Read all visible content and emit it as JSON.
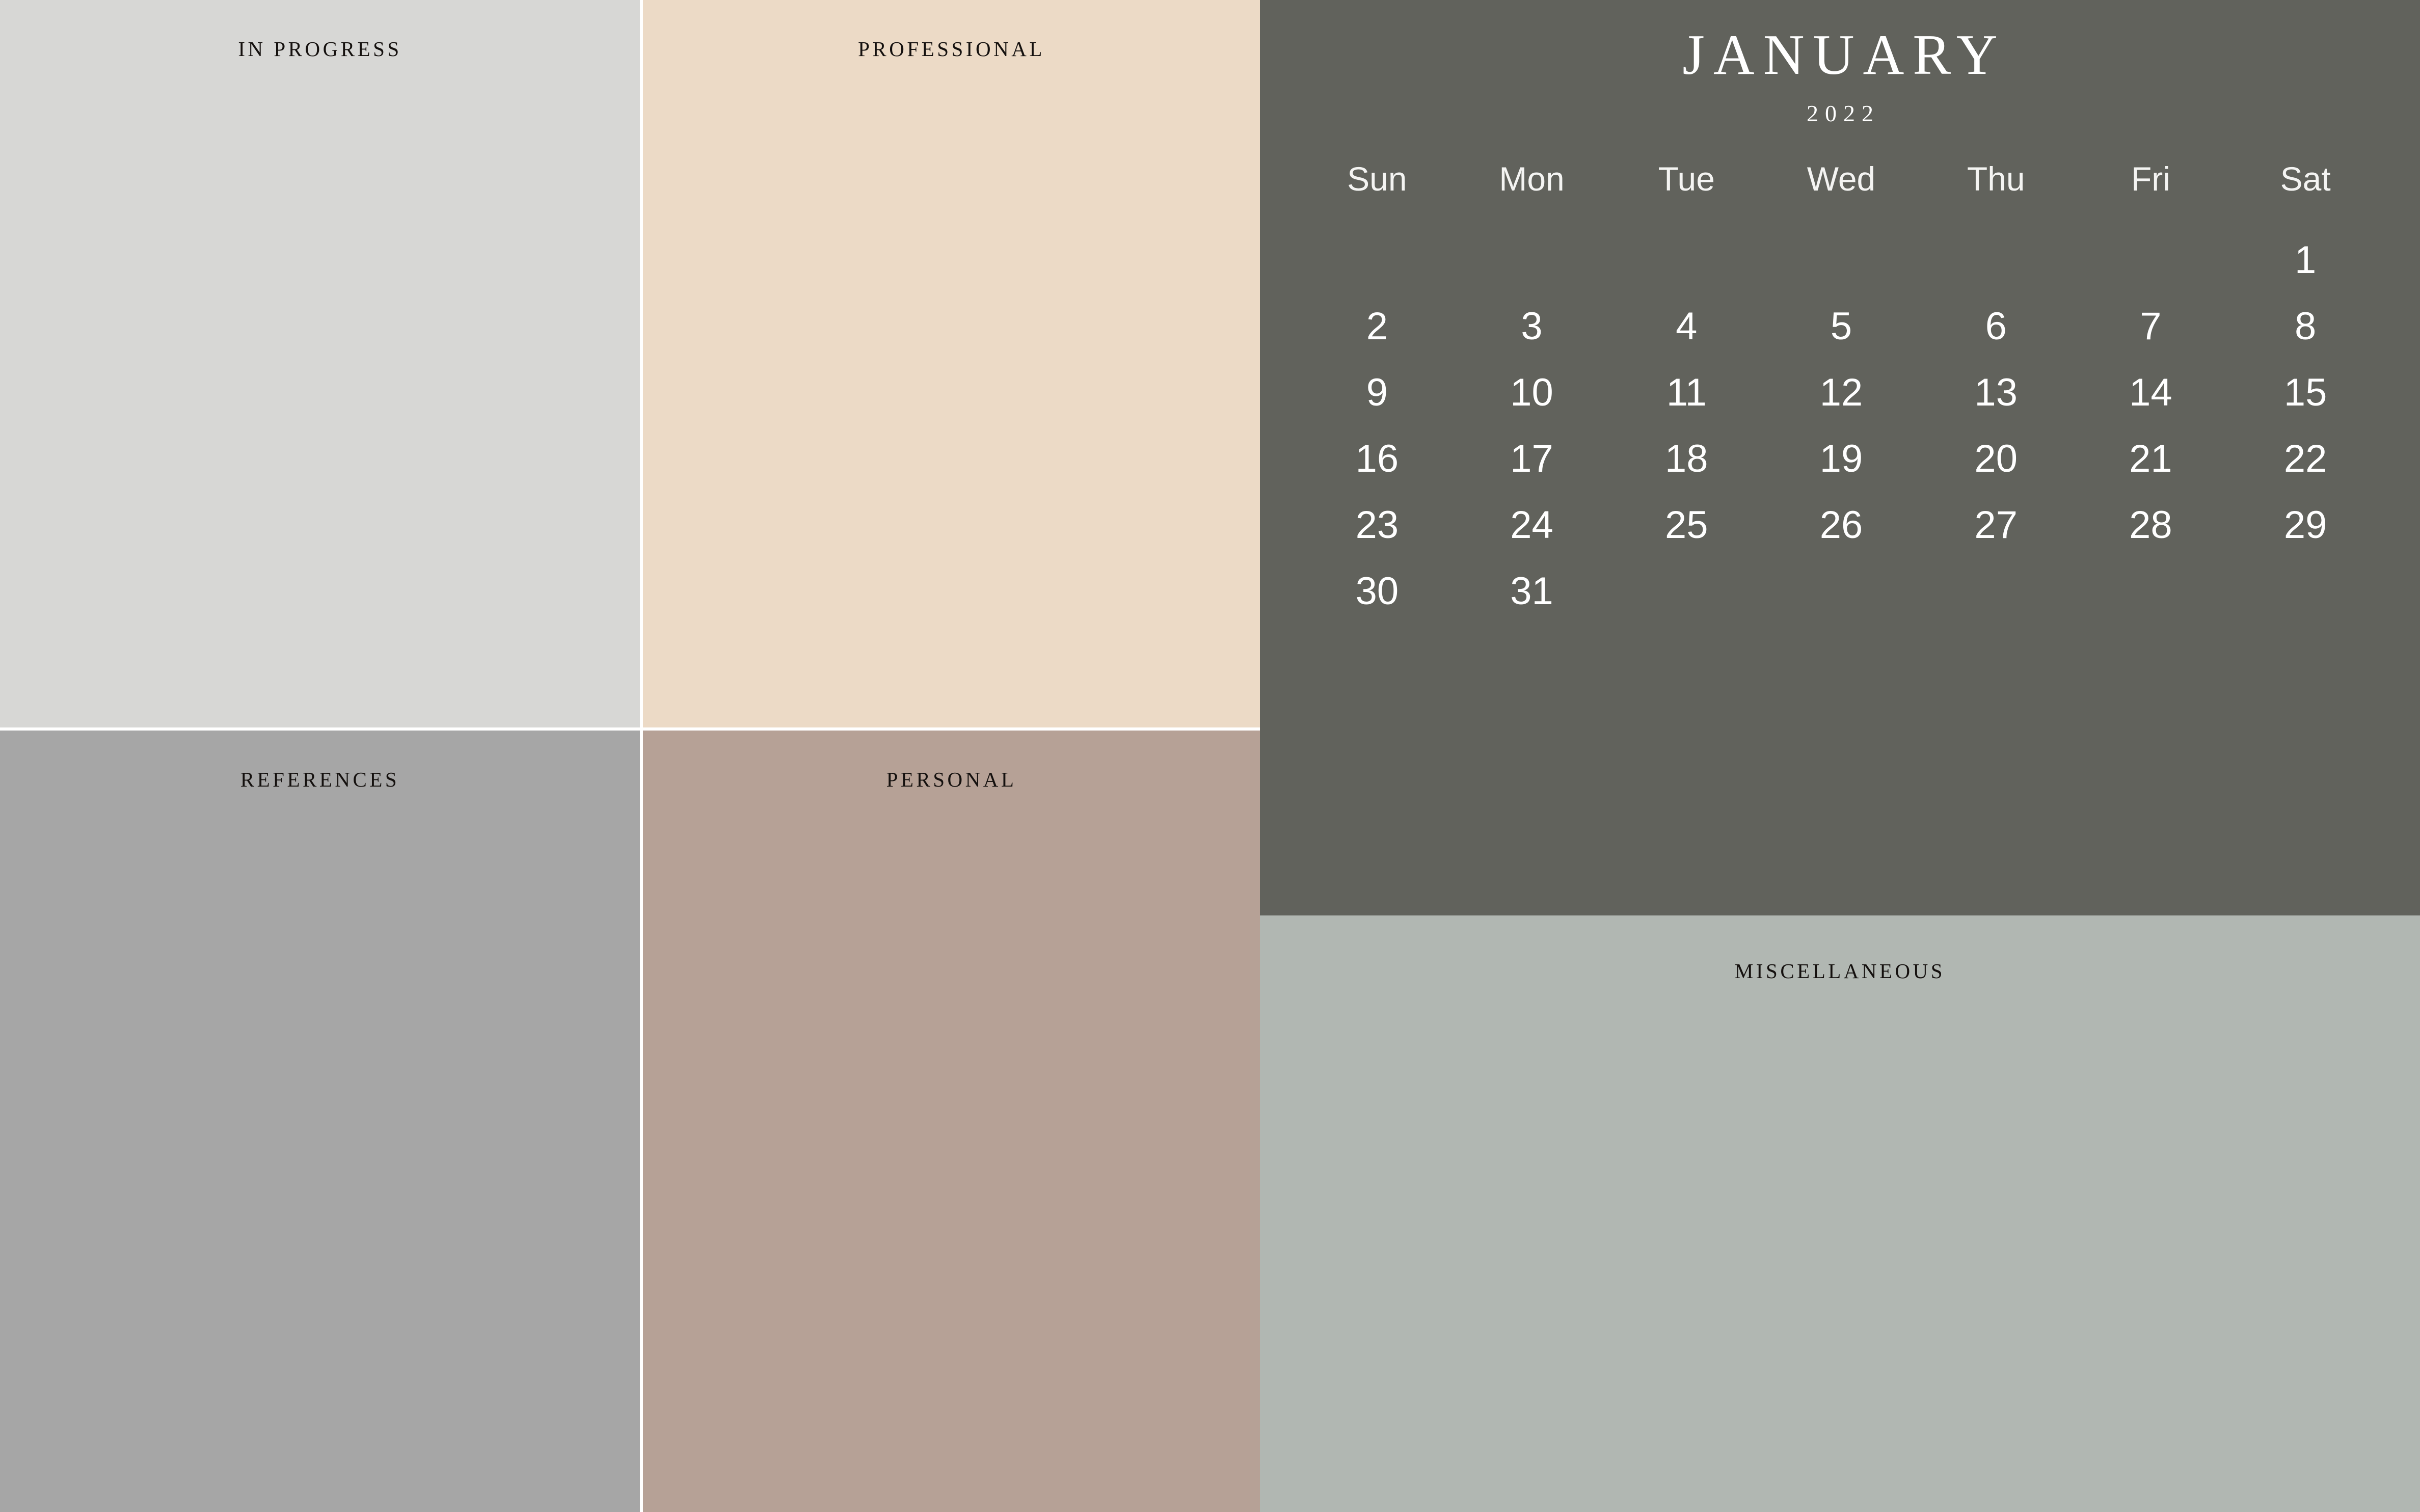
{
  "panels": {
    "in_progress": {
      "label": "IN PROGRESS",
      "color": "#d7d7d5"
    },
    "professional": {
      "label": "PROFESSIONAL",
      "color": "#ecdac6"
    },
    "references": {
      "label": "REFERENCES",
      "color": "#a6a6a6"
    },
    "personal": {
      "label": "PERSONAL",
      "color": "#b6a196"
    },
    "miscellaneous": {
      "label": "MISCELLANEOUS",
      "color": "#b1b7b2"
    }
  },
  "calendar": {
    "month": "JANUARY",
    "year": "2022",
    "background_color": "#61625c",
    "text_color": "#ffffff",
    "weekdays": [
      "Sun",
      "Mon",
      "Tue",
      "Wed",
      "Thu",
      "Fri",
      "Sat"
    ],
    "weeks": [
      [
        "",
        "",
        "",
        "",
        "",
        "",
        "1"
      ],
      [
        "2",
        "3",
        "4",
        "5",
        "6",
        "7",
        "8"
      ],
      [
        "9",
        "10",
        "11",
        "12",
        "13",
        "14",
        "15"
      ],
      [
        "16",
        "17",
        "18",
        "19",
        "20",
        "21",
        "22"
      ],
      [
        "23",
        "24",
        "25",
        "26",
        "27",
        "28",
        "29"
      ],
      [
        "30",
        "31",
        "",
        "",
        "",
        "",
        ""
      ]
    ]
  }
}
